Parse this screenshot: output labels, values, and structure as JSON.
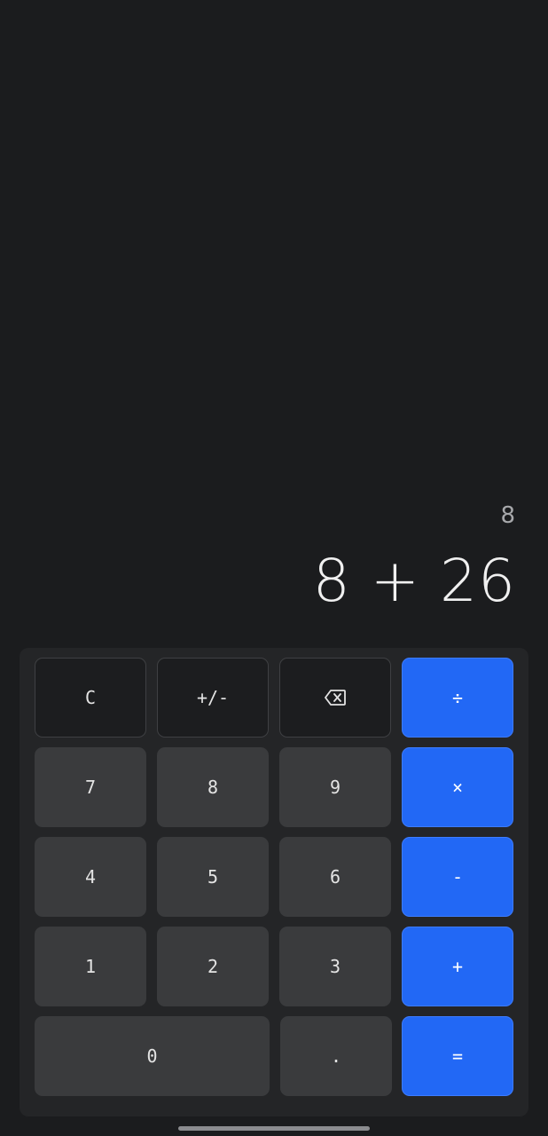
{
  "display": {
    "preview_result": "8",
    "expression": "8 + 26"
  },
  "keypad": {
    "row1": {
      "clear": "C",
      "sign": "+/-",
      "backspace_icon": "backspace-icon",
      "divide": "÷"
    },
    "row2": {
      "seven": "7",
      "eight": "8",
      "nine": "9",
      "multiply": "×"
    },
    "row3": {
      "four": "4",
      "five": "5",
      "six": "6",
      "minus": "-"
    },
    "row4": {
      "one": "1",
      "two": "2",
      "three": "3",
      "plus": "+"
    },
    "row5": {
      "zero": "0",
      "decimal": ".",
      "equals": "="
    }
  },
  "colors": {
    "background": "#1b1c1e",
    "keypad": "#242527",
    "number_key": "#3a3b3d",
    "function_key": "#1c1d1f",
    "operator_key": "#2268f5"
  }
}
